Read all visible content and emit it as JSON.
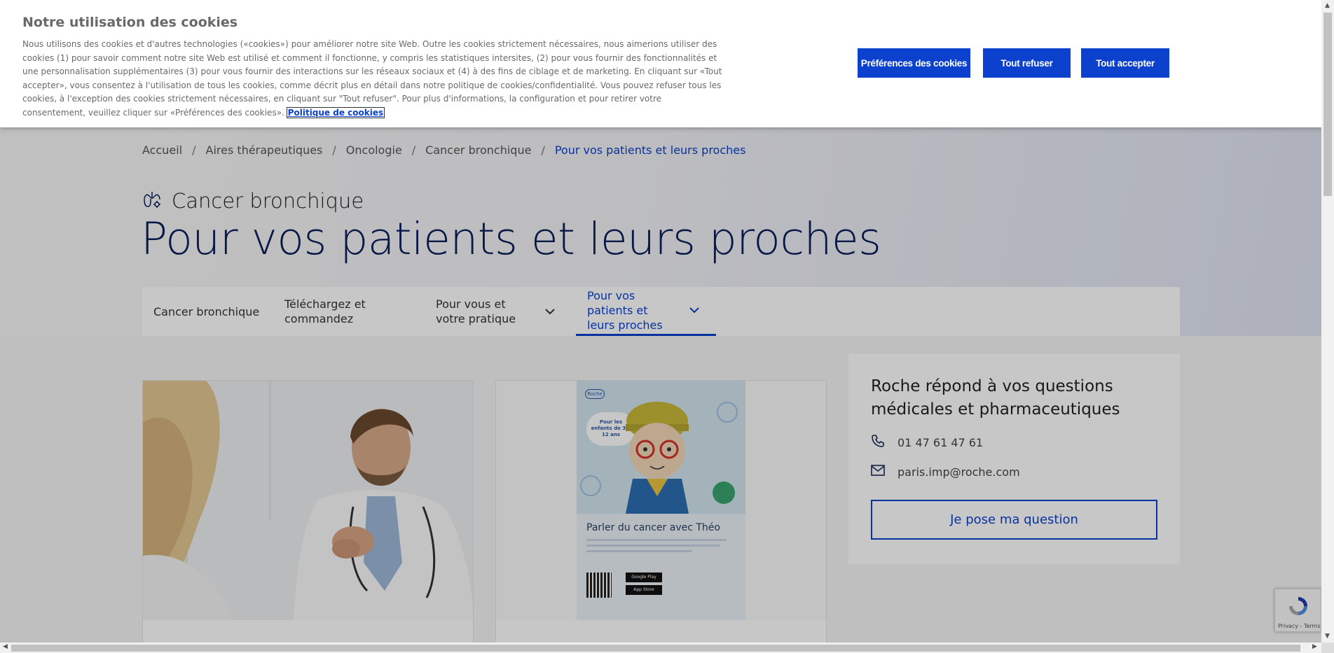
{
  "cookie_banner": {
    "title": "Notre utilisation des cookies",
    "text": "Nous utilisons des cookies et d'autres technologies («cookies») pour améliorer notre site Web. Outre les cookies strictement nécessaires, nous aimerions utiliser des cookies (1) pour savoir comment notre site Web est utilisé et comment il fonctionne, y compris les statistiques intersites, (2) pour vous fournir des fonctionnalités et une personnalisation supplémentaires (3) pour vous fournir des interactions sur les réseaux sociaux et (4) à des fins de ciblage et de marketing. En cliquant sur «Tout accepter», vous consentez à l'utilisation de tous les cookies, comme décrit plus en détail dans notre politique de cookies/confidentialité. Vous pouvez refuser tous les cookies, à l'exception des cookies strictement nécessaires, en cliquant sur \"Tout refuser\". Pour plus d'informations, la configuration et pour retirer votre consentement, veuillez cliquer sur «Préférences des cookies».",
    "policy_link": "Politique de cookies",
    "preferences_button": "Préférences des cookies",
    "reject_button": "Tout refuser",
    "accept_button": "Tout accepter",
    "button_color": "#0b41cd"
  },
  "breadcrumb": {
    "items": [
      "Accueil",
      "Aires thérapeutiques",
      "Oncologie",
      "Cancer bronchique"
    ],
    "current": "Pour vos patients et leurs proches",
    "separator": "/"
  },
  "header": {
    "icon": "lungs-icon",
    "subtitle": "Cancer bronchique",
    "title": "Pour vos patients et leurs proches"
  },
  "tabs": [
    {
      "label": "Cancer bronchique",
      "dropdown": false,
      "active": false
    },
    {
      "label": "Téléchargez et commandez",
      "dropdown": false,
      "active": false
    },
    {
      "label": "Pour vous et votre pratique",
      "dropdown": true,
      "active": false
    },
    {
      "label": "Pour vos patients et leurs proches",
      "dropdown": true,
      "active": true
    }
  ],
  "poster": {
    "brand": "Roche",
    "bubble": "Pour les enfants de 3 à 12 ans",
    "heading": "Parler du cancer avec Théo",
    "store1": "Google Play",
    "store2": "App Store"
  },
  "contact": {
    "title": "Roche répond à vos questions médicales et pharmaceutiques",
    "phone": "01 47 61 47 61",
    "email": "paris.imp@roche.com",
    "button": "Je pose ma question"
  },
  "recaptcha": {
    "terms": "Privacy - Terms"
  },
  "colors": {
    "accent": "#0b41cd",
    "title": "#0b1f5c"
  }
}
